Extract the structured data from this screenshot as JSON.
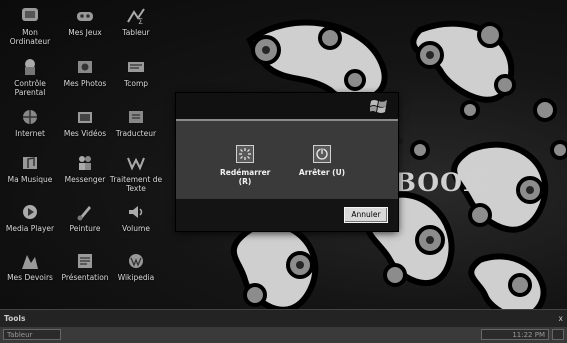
{
  "desktop": {
    "icons": [
      {
        "label": "Mon Ordinateur",
        "icon": "computer-icon"
      },
      {
        "label": "Mes Jeux",
        "icon": "games-icon"
      },
      {
        "label": "Tableur",
        "icon": "spreadsheet-icon"
      },
      {
        "label": "Contrôle Parental",
        "icon": "parental-control-icon"
      },
      {
        "label": "Mes Photos",
        "icon": "photos-icon"
      },
      {
        "label": "Tcomp",
        "icon": "tcomp-icon"
      },
      {
        "label": "Internet",
        "icon": "internet-icon"
      },
      {
        "label": "Mes Vidéos",
        "icon": "videos-icon"
      },
      {
        "label": "Traducteur",
        "icon": "translator-icon"
      },
      {
        "label": "Ma Musique",
        "icon": "music-icon"
      },
      {
        "label": "Messenger",
        "icon": "messenger-icon"
      },
      {
        "label": "Traitement de Texte",
        "icon": "word-processor-icon"
      },
      {
        "label": "Media Player",
        "icon": "media-player-icon"
      },
      {
        "label": "Peinture",
        "icon": "paint-icon"
      },
      {
        "label": "Volume",
        "icon": "volume-icon"
      },
      {
        "label": "Mes Devoirs",
        "icon": "homework-icon"
      },
      {
        "label": "Présentation",
        "icon": "presentation-icon"
      },
      {
        "label": "Wikipedia",
        "icon": "wikipedia-icon"
      }
    ],
    "wallpaper_text": "IBOOK"
  },
  "dialog": {
    "logo": "windows-flag-icon",
    "options": [
      {
        "label": "Redémarrer (R)",
        "icon": "restart-icon"
      },
      {
        "label": "Arrêter (U)",
        "icon": "power-icon"
      }
    ],
    "cancel_label": "Annuler"
  },
  "taskbar": {
    "tools_title": "Tools",
    "close": "x",
    "window_button": "Tableur",
    "tray_text": "11:22 PM"
  }
}
